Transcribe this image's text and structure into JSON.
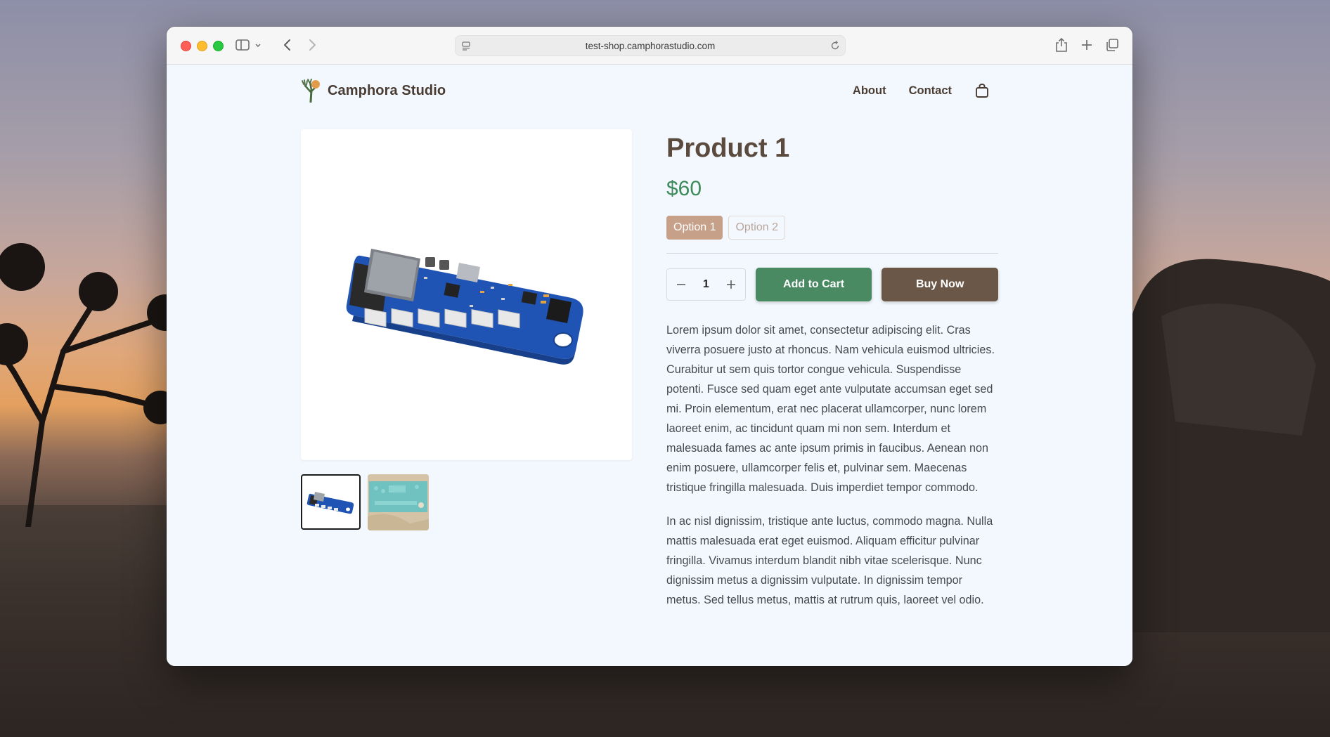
{
  "browser": {
    "url": "test-shop.camphorastudio.com"
  },
  "site": {
    "brand": "Camphora Studio",
    "nav": [
      {
        "label": "About"
      },
      {
        "label": "Contact"
      }
    ]
  },
  "product": {
    "title": "Product 1",
    "price": "$60",
    "options": [
      {
        "label": "Option 1",
        "selected": true
      },
      {
        "label": "Option 2",
        "selected": false
      }
    ],
    "quantity": "1",
    "add_to_cart_label": "Add to Cart",
    "buy_now_label": "Buy Now",
    "description": [
      "Lorem ipsum dolor sit amet, consectetur adipiscing elit. Cras viverra posuere justo at rhoncus. Nam vehicula euismod ultricies. Curabitur ut sem quis tortor congue vehicula. Suspendisse potenti. Fusce sed quam eget ante vulputate accumsan eget sed mi. Proin elementum, erat nec placerat ullamcorper, nunc lorem laoreet enim, ac tincidunt quam mi non sem. Interdum et malesuada fames ac ante ipsum primis in faucibus. Aenean non enim posuere, ullamcorper felis et, pulvinar sem. Maecenas tristique fringilla malesuada. Duis imperdiet tempor commodo.",
      "In ac nisl dignissim, tristique ante luctus, commodo magna. Nulla mattis malesuada erat eget euismod. Aliquam efficitur pulvinar fringilla. Vivamus interdum blandit nibh vitae scelerisque. Nunc dignissim metus a dignissim vulputate. In dignissim tempor metus. Sed tellus metus, mattis at rutrum quis, laoreet vel odio."
    ],
    "thumbnails": [
      {
        "active": true
      },
      {
        "active": false
      }
    ]
  },
  "colors": {
    "accent_green": "#4a8a63",
    "brown": "#6b5747",
    "option_selected": "#c7a08a",
    "page_bg": "#f2f8fd"
  }
}
